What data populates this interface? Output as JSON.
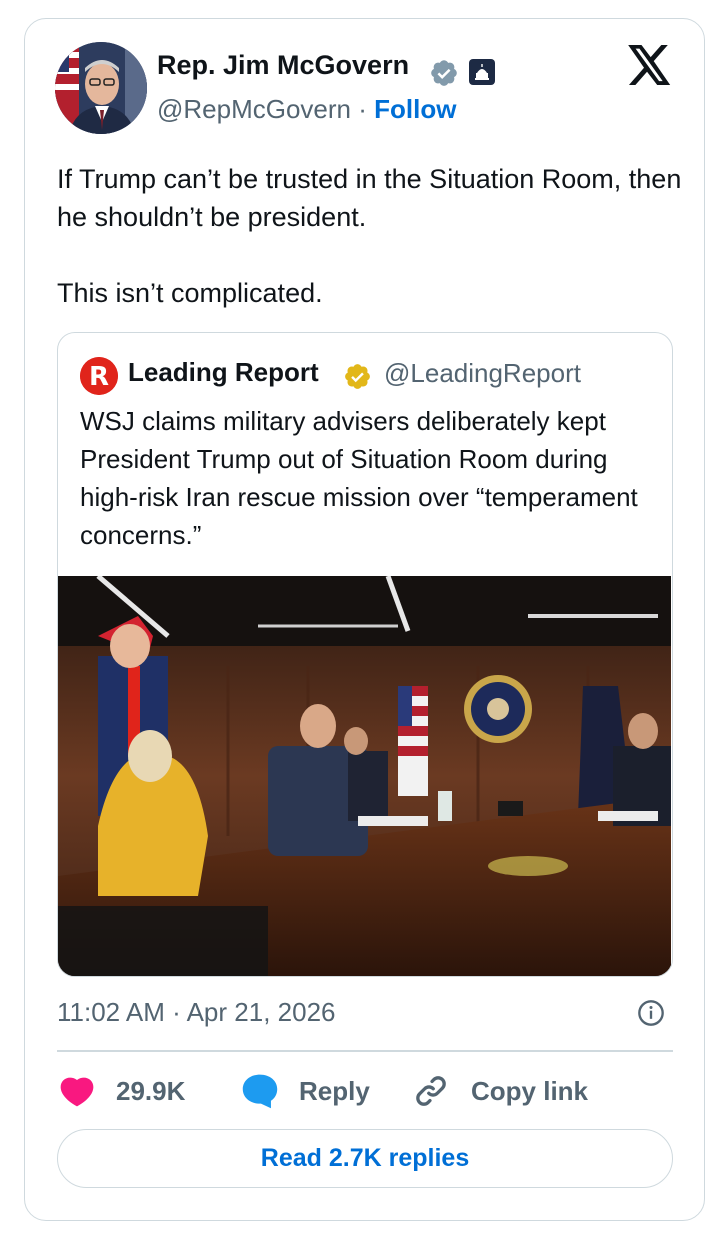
{
  "author": {
    "name": "Rep. Jim McGovern",
    "handle": "@RepMcGovern",
    "separator": "·",
    "follow_label": "Follow",
    "verified": "gray-verified-badge",
    "affiliation": "us-capitol-badge"
  },
  "tweet": {
    "paragraphs": [
      "If Trump can’t be trusted in the Situation Room, then he shouldn’t be president.",
      "This isn’t complicated."
    ],
    "timestamp": "11:02 AM · Apr 21, 2026"
  },
  "quoted": {
    "name": "Leading Report",
    "handle": "@LeadingReport",
    "verified": "gold-verified-badge",
    "text": "WSJ claims military advisers deliberately kept President Trump out of Situation Room during high-risk Iran rescue mission over “temperament concerns.”",
    "photo": "situation-room-meeting-photo"
  },
  "actions": {
    "like_count": "29.9K",
    "reply_label": "Reply",
    "copy_label": "Copy link"
  },
  "read_replies_label": "Read 2.7K replies",
  "colors": {
    "link": "#006fd6",
    "like": "#f91880",
    "reply": "#1d9bf0",
    "muted": "#536471",
    "border": "#cfd9de"
  }
}
